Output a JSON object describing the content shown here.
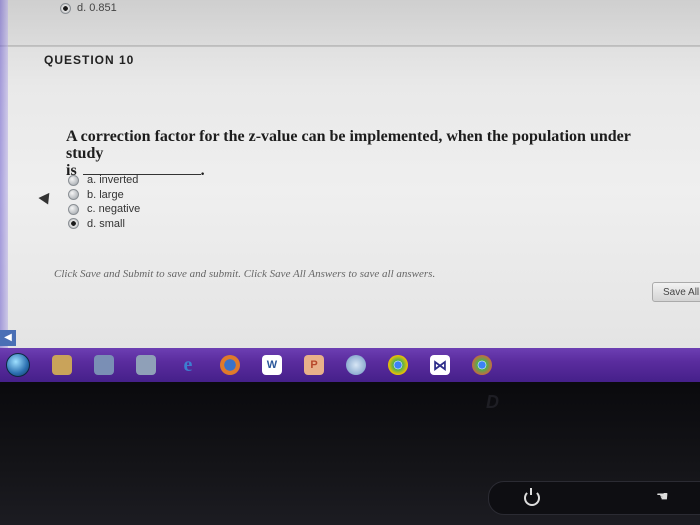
{
  "previous_answer": {
    "label": "d. 0.851"
  },
  "question": {
    "title": "QUESTION 10",
    "text_line1": "A correction factor for the z-value can be implemented, when the population under study",
    "text_line2": "is",
    "text_end": ".",
    "options": [
      {
        "label": "a. inverted",
        "selected": false
      },
      {
        "label": "b. large",
        "selected": false
      },
      {
        "label": "c. negative",
        "selected": false
      },
      {
        "label": "d. small",
        "selected": true
      }
    ]
  },
  "footer": {
    "instruction": "Click Save and Submit to save and submit. Click Save All Answers to save all answers.",
    "save_all_label": "Save All"
  },
  "taskbar": {
    "icons": [
      {
        "name": "start-orb-icon"
      },
      {
        "name": "file-explorer-icon",
        "color": "#c9a35a"
      },
      {
        "name": "document-icon",
        "color": "#7a8fb5"
      },
      {
        "name": "media-player-icon",
        "color": "#8fa0b8"
      },
      {
        "name": "internet-explorer-icon",
        "color": "#3c7fd1",
        "glyph": "e"
      },
      {
        "name": "firefox-icon",
        "color": "#e07a2a"
      },
      {
        "name": "word-icon",
        "color": "#ffffff",
        "glyph": "W"
      },
      {
        "name": "powerpoint-icon",
        "color": "#e8b08a",
        "glyph": "P"
      },
      {
        "name": "globe-icon",
        "color": "#a7c3e0"
      },
      {
        "name": "chrome-icon",
        "color": "#4caf50"
      },
      {
        "name": "visual-studio-icon",
        "color": "#2d2d8a"
      },
      {
        "name": "chrome-alt-icon",
        "color": "#e55a3d"
      }
    ]
  },
  "bezel": {
    "brand": "D"
  }
}
